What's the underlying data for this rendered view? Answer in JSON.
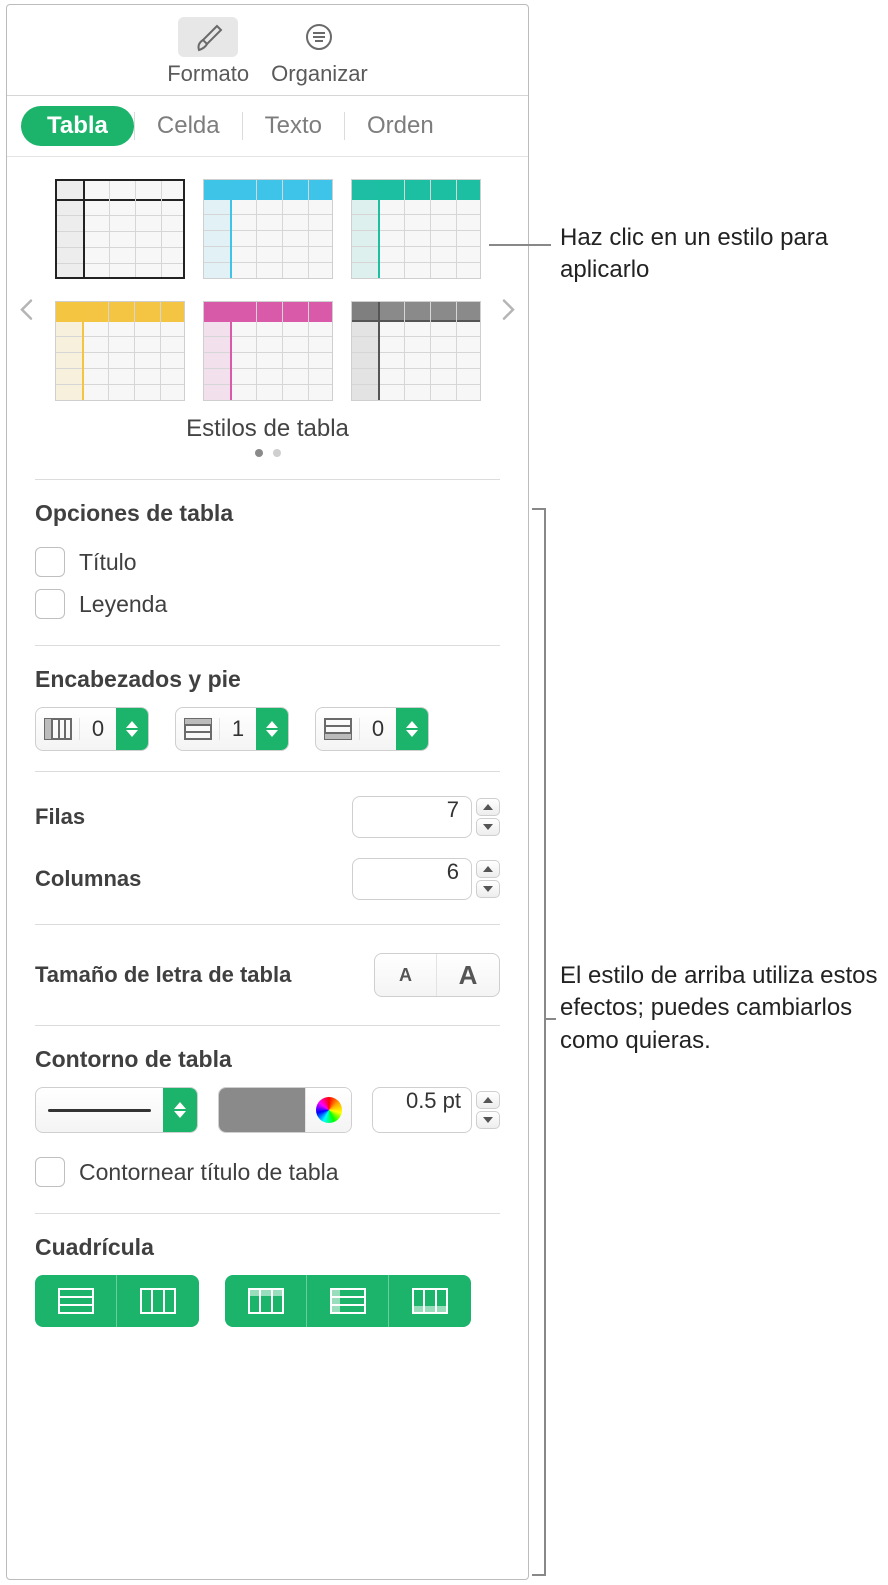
{
  "toolbar": {
    "format_label": "Formato",
    "organize_label": "Organizar"
  },
  "tabs": {
    "table": "Tabla",
    "cell": "Celda",
    "text": "Texto",
    "order": "Orden"
  },
  "gallery": {
    "caption": "Estilos de tabla",
    "styles": [
      {
        "accent": "#ffffff",
        "border": "#222222"
      },
      {
        "accent": "#3ec4e8"
      },
      {
        "accent": "#1dbfa3"
      },
      {
        "accent": "#f4c542"
      },
      {
        "accent": "#d85aa8"
      },
      {
        "accent": "#8a8a8a"
      }
    ]
  },
  "options": {
    "section_title": "Opciones de tabla",
    "title_label": "Título",
    "caption_label": "Leyenda"
  },
  "headers": {
    "section_title": "Encabezados y pie",
    "col_headers": "0",
    "row_headers": "1",
    "footers": "0"
  },
  "dims": {
    "rows_label": "Filas",
    "cols_label": "Columnas",
    "rows_value": "7",
    "cols_value": "6"
  },
  "font": {
    "label": "Tamaño de letra de tabla"
  },
  "outline": {
    "section_title": "Contorno de tabla",
    "width_value": "0.5 pt",
    "color": "#8a8a8a",
    "outline_title_label": "Contornear título de tabla"
  },
  "gridlines": {
    "section_title": "Cuadrícula"
  },
  "callouts": {
    "top": "Haz clic en un estilo para aplicarlo",
    "bottom": "El estilo de arriba utiliza estos efectos; puedes cambiarlos como quieras."
  }
}
